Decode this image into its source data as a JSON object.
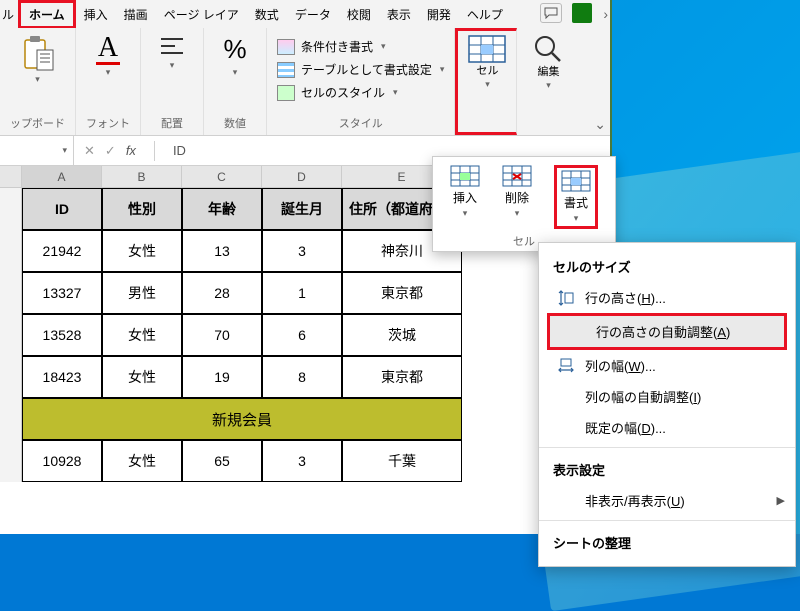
{
  "menubar": {
    "tabs_left_cut": "ル",
    "tabs": [
      "ホーム",
      "挿入",
      "描画",
      "ページ レイア",
      "数式",
      "データ",
      "校閲",
      "表示",
      "開発",
      "ヘルプ"
    ]
  },
  "ribbon": {
    "clipboard": {
      "label": "ップボード"
    },
    "font": {
      "label": "フォント"
    },
    "align": {
      "label": "配置"
    },
    "number": {
      "label": "数値"
    },
    "styles": {
      "cond": "条件付き書式",
      "table": "テーブルとして書式設定",
      "cell_style": "セルのスタイル",
      "group": "スタイル"
    },
    "cells": {
      "label": "セル"
    },
    "edit": {
      "label": "編集"
    }
  },
  "formula": {
    "namebox": "",
    "fx": "fx",
    "value": "ID"
  },
  "columns": [
    "A",
    "B",
    "C",
    "D",
    "E"
  ],
  "table": {
    "headers": [
      "ID",
      "性別",
      "年齢",
      "誕生月",
      "住所（都道府県"
    ],
    "rows": [
      [
        "21942",
        "女性",
        "13",
        "3",
        "神奈川"
      ],
      [
        "13327",
        "男性",
        "28",
        "1",
        "東京都"
      ],
      [
        "13528",
        "女性",
        "70",
        "6",
        "茨城"
      ],
      [
        "18423",
        "女性",
        "19",
        "8",
        "東京都"
      ]
    ],
    "merged": "新規会員",
    "rows2": [
      [
        "10928",
        "女性",
        "65",
        "3",
        "千葉"
      ]
    ]
  },
  "cells_popup": {
    "insert": "挿入",
    "delete": "削除",
    "format": "書式",
    "group": "セル"
  },
  "context": {
    "section1": "セルのサイズ",
    "row_height": "行の高さ(",
    "row_height_key": "H",
    "row_height_end": ")...",
    "autofit_row": "行の高さの自動調整(",
    "autofit_row_key": "A",
    "autofit_row_end": ")",
    "col_width": "列の幅(",
    "col_width_key": "W",
    "col_width_end": ")...",
    "autofit_col": "列の幅の自動調整(",
    "autofit_col_key": "I",
    "autofit_col_end": ")",
    "default_w": "既定の幅(",
    "default_w_key": "D",
    "default_w_end": ")...",
    "section2": "表示設定",
    "hide_show": "非表示/再表示(",
    "hide_show_key": "U",
    "hide_show_end": ")",
    "section3": "シートの整理"
  }
}
